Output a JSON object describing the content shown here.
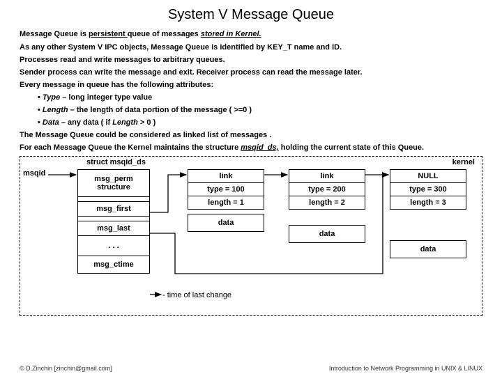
{
  "title": "System V Message Queue",
  "intro_pre": "Message Queue is ",
  "intro_persistent": "persistent ",
  "intro_mid": "queue of messages ",
  "intro_stored": "stored  in Kernel.",
  "l1": "As any other System V IPC objects, Message Queue is identified by KEY_T name and ID.",
  "l2": "Processes read and write messages to arbitrary queues.",
  "l3": "Sender process can write the message and exit. Receiver process can read the message later.",
  "l4": "Every message in queue has the following attributes:",
  "b1_label": "Type",
  "b1_rest": " – long integer type value",
  "b2_label": "Length",
  "b2_rest": " – the length of data portion of the message ( >=0 )",
  "b3_label": "Data",
  "b3_mid": " – any data ( if ",
  "b3_len": "Length",
  "b3_end": " > 0 )",
  "l5": "The Message Queue could be considered as linked list of messages .",
  "l6_pre": "For each Message Queue the Kernel maintains the structure ",
  "l6_struct": "msqid_ds,",
  "l6_post": " holding the current state of this Queue.",
  "kernel": "kernel",
  "struct_title": "struct msqid_ds",
  "msqid": "msqid",
  "fields": {
    "perm": "msg_perm structure",
    "first": "msg_first",
    "last": "msg_last",
    "dots": ". . .",
    "ctime": "msg_ctime"
  },
  "nodes": [
    {
      "link": "link",
      "type": "type = 100",
      "length": "length = 1",
      "data": "data"
    },
    {
      "link": "link",
      "type": "type = 200",
      "length": "length = 2",
      "data": "data"
    },
    {
      "link": "NULL",
      "type": "type = 300",
      "length": "length = 3",
      "data": "data"
    }
  ],
  "timechg": "- time of last change",
  "footer_left": "© D.Zinchin [zinchin@gmail.com]",
  "footer_right": "Introduction to Network Programming in UNIX & LINUX"
}
